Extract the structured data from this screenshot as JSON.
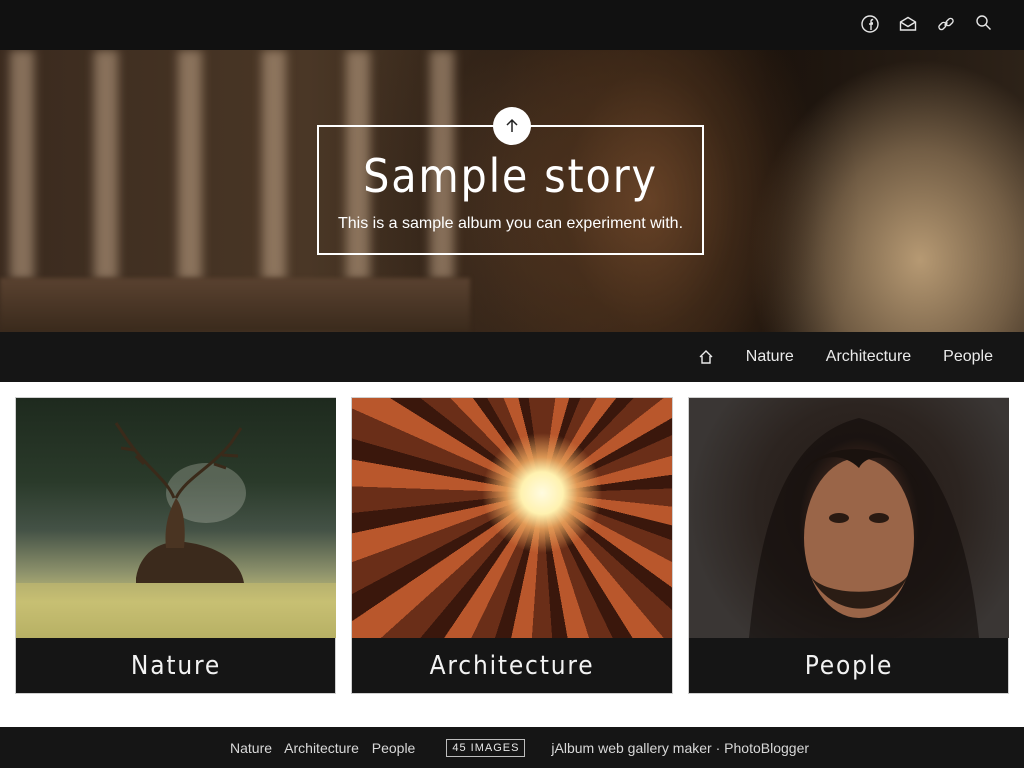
{
  "topbar": {
    "icons": [
      "facebook-icon",
      "email-icon",
      "link-icon",
      "search-icon"
    ]
  },
  "hero": {
    "title": "Sample story",
    "description": "This is a sample album you can experiment with."
  },
  "nav": {
    "items": [
      {
        "label": "Nature"
      },
      {
        "label": "Architecture"
      },
      {
        "label": "People"
      }
    ]
  },
  "cards": [
    {
      "label": "Nature"
    },
    {
      "label": "Architecture"
    },
    {
      "label": "People"
    }
  ],
  "footer": {
    "links": [
      "Nature",
      "Architecture",
      "People"
    ],
    "badge": "45 images",
    "credit_maker": "jAlbum web gallery maker",
    "separator": "·",
    "credit_skin": "PhotoBlogger"
  },
  "colors": {
    "bar_background": "#151515",
    "page_background": "#ffffff",
    "text_light": "#eaeaea"
  }
}
